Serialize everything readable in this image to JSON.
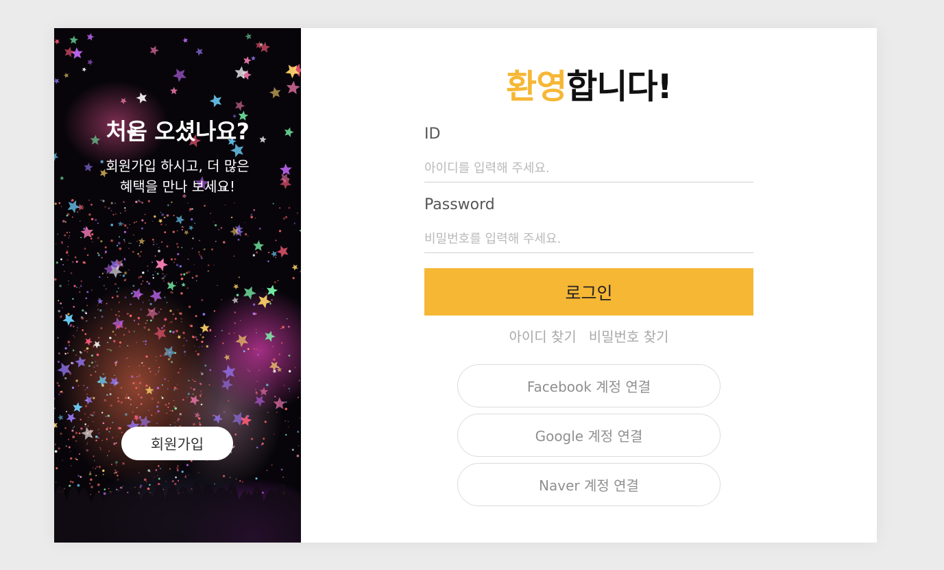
{
  "side_panel": {
    "title": "처음 오셨나요?",
    "description_line1": "회원가입 하시고, 더 많은",
    "description_line2": "혜택을 만나 보세요!",
    "signup_label": "회원가입",
    "background": "confetti-concert-image"
  },
  "login": {
    "welcome_accent": "환영",
    "welcome_rest": "합니다!",
    "id_label": "ID",
    "id_placeholder": "아이디를 입력해 주세요.",
    "id_value": "",
    "password_label": "Password",
    "password_placeholder": "비밀번호를 입력해 주세요.",
    "password_value": "",
    "submit_label": "로그인",
    "find_id_label": "아이디 찾기",
    "find_password_label": "비밀번호 찾기"
  },
  "social": [
    {
      "label": "Facebook 계정 연결"
    },
    {
      "label": "Google 계정 연결"
    },
    {
      "label": "Naver 계정 연결"
    }
  ],
  "colors": {
    "accent": "#f6b735",
    "page_background": "#ebebeb",
    "card_background": "#ffffff",
    "muted_text": "#a9a9a9"
  }
}
